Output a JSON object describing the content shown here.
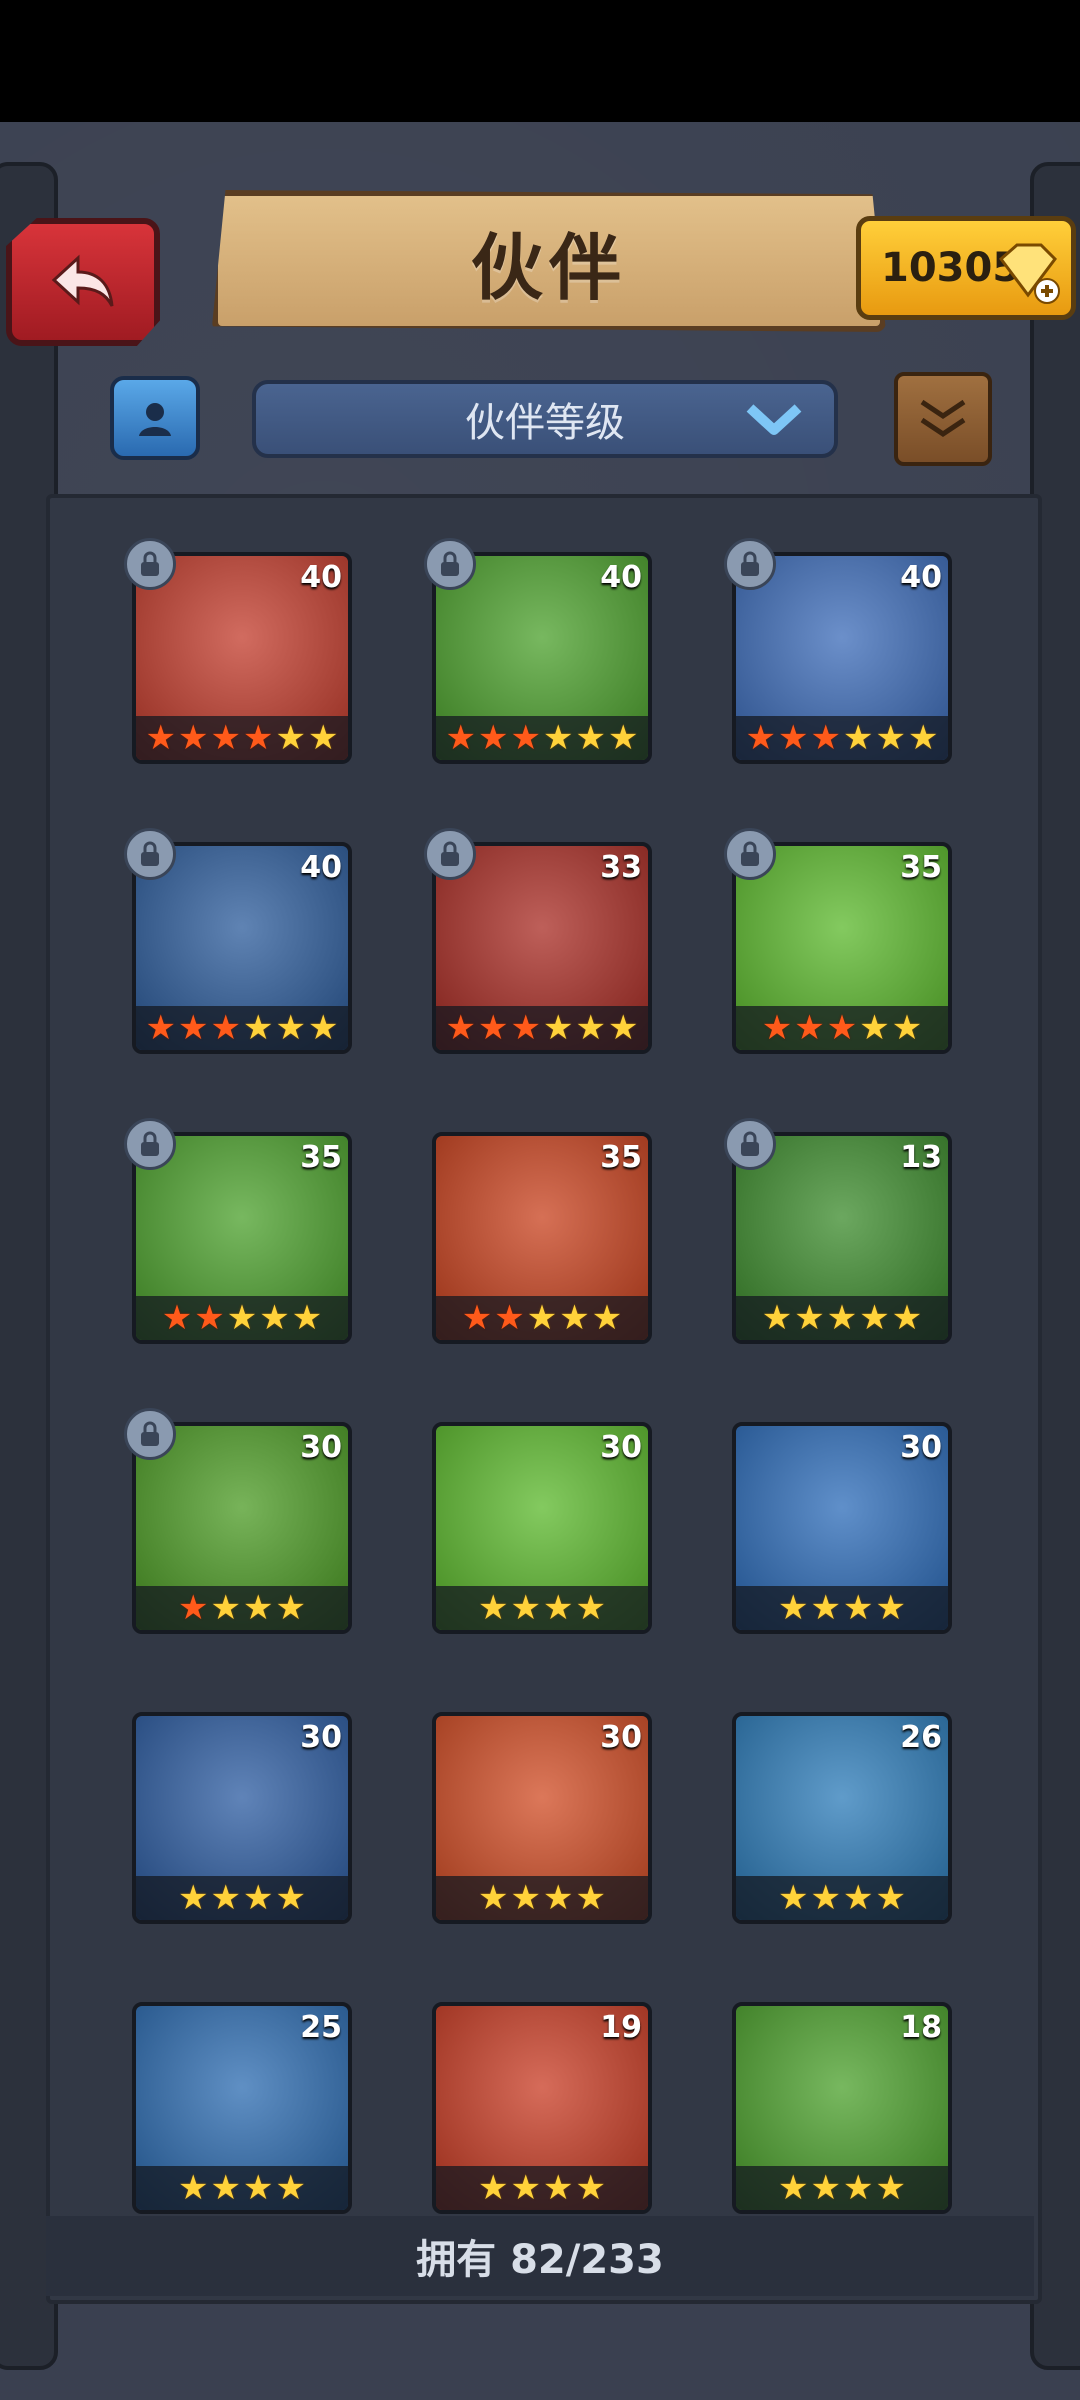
{
  "header": {
    "title": "伙伴",
    "back_icon": "back-arrow-icon"
  },
  "currency": {
    "amount": "10305",
    "icon": "gem-plus-icon"
  },
  "toolbar": {
    "filter_icon": "companion-filter-icon",
    "sort_label": "伙伴等级",
    "scroll_icon": "scroll-icon"
  },
  "cards": [
    {
      "level": "40",
      "locked": true,
      "stars": [
        "red",
        "red",
        "red",
        "red",
        "gold",
        "gold"
      ],
      "color": "#c23a2a"
    },
    {
      "level": "40",
      "locked": true,
      "stars": [
        "red",
        "red",
        "red",
        "gold",
        "gold",
        "gold"
      ],
      "color": "#4aa02a"
    },
    {
      "level": "40",
      "locked": true,
      "stars": [
        "red",
        "red",
        "red",
        "gold",
        "gold",
        "gold"
      ],
      "color": "#3a6ab8"
    },
    {
      "level": "40",
      "locked": true,
      "stars": [
        "red",
        "red",
        "red",
        "gold",
        "gold",
        "gold"
      ],
      "color": "#2a5a9a"
    },
    {
      "level": "33",
      "locked": true,
      "stars": [
        "red",
        "red",
        "red",
        "gold",
        "gold",
        "gold"
      ],
      "color": "#a82a22"
    },
    {
      "level": "35",
      "locked": true,
      "stars": [
        "red",
        "red",
        "red",
        "gold",
        "gold"
      ],
      "color": "#5ab82a"
    },
    {
      "level": "35",
      "locked": true,
      "stars": [
        "red",
        "red",
        "gold",
        "gold",
        "gold"
      ],
      "color": "#4aa02a"
    },
    {
      "level": "35",
      "locked": false,
      "stars": [
        "red",
        "red",
        "gold",
        "gold",
        "gold"
      ],
      "color": "#c8401c"
    },
    {
      "level": "13",
      "locked": true,
      "stars": [
        "gold",
        "gold",
        "gold",
        "gold",
        "gold"
      ],
      "color": "#3a8a2a"
    },
    {
      "level": "30",
      "locked": true,
      "stars": [
        "red",
        "gold",
        "gold",
        "gold"
      ],
      "color": "#4a9a22"
    },
    {
      "level": "30",
      "locked": false,
      "stars": [
        "gold",
        "gold",
        "gold",
        "gold"
      ],
      "color": "#5ab82a"
    },
    {
      "level": "30",
      "locked": false,
      "stars": [
        "gold",
        "gold",
        "gold",
        "gold"
      ],
      "color": "#2a6ab8"
    },
    {
      "level": "30",
      "locked": false,
      "stars": [
        "gold",
        "gold",
        "gold",
        "gold"
      ],
      "color": "#2a5aa0"
    },
    {
      "level": "30",
      "locked": false,
      "stars": [
        "gold",
        "gold",
        "gold",
        "gold"
      ],
      "color": "#d04a22"
    },
    {
      "level": "26",
      "locked": false,
      "stars": [
        "gold",
        "gold",
        "gold",
        "gold"
      ],
      "color": "#2a7ab8"
    },
    {
      "level": "25",
      "locked": false,
      "stars": [
        "gold",
        "gold",
        "gold",
        "gold"
      ],
      "color": "#2a6ab0"
    },
    {
      "level": "19",
      "locked": false,
      "stars": [
        "gold",
        "gold",
        "gold",
        "gold"
      ],
      "color": "#c83a22"
    },
    {
      "level": "18",
      "locked": false,
      "stars": [
        "gold",
        "gold",
        "gold",
        "gold"
      ],
      "color": "#4aa02a"
    }
  ],
  "footer": {
    "owned_text": "拥有 82/233"
  }
}
